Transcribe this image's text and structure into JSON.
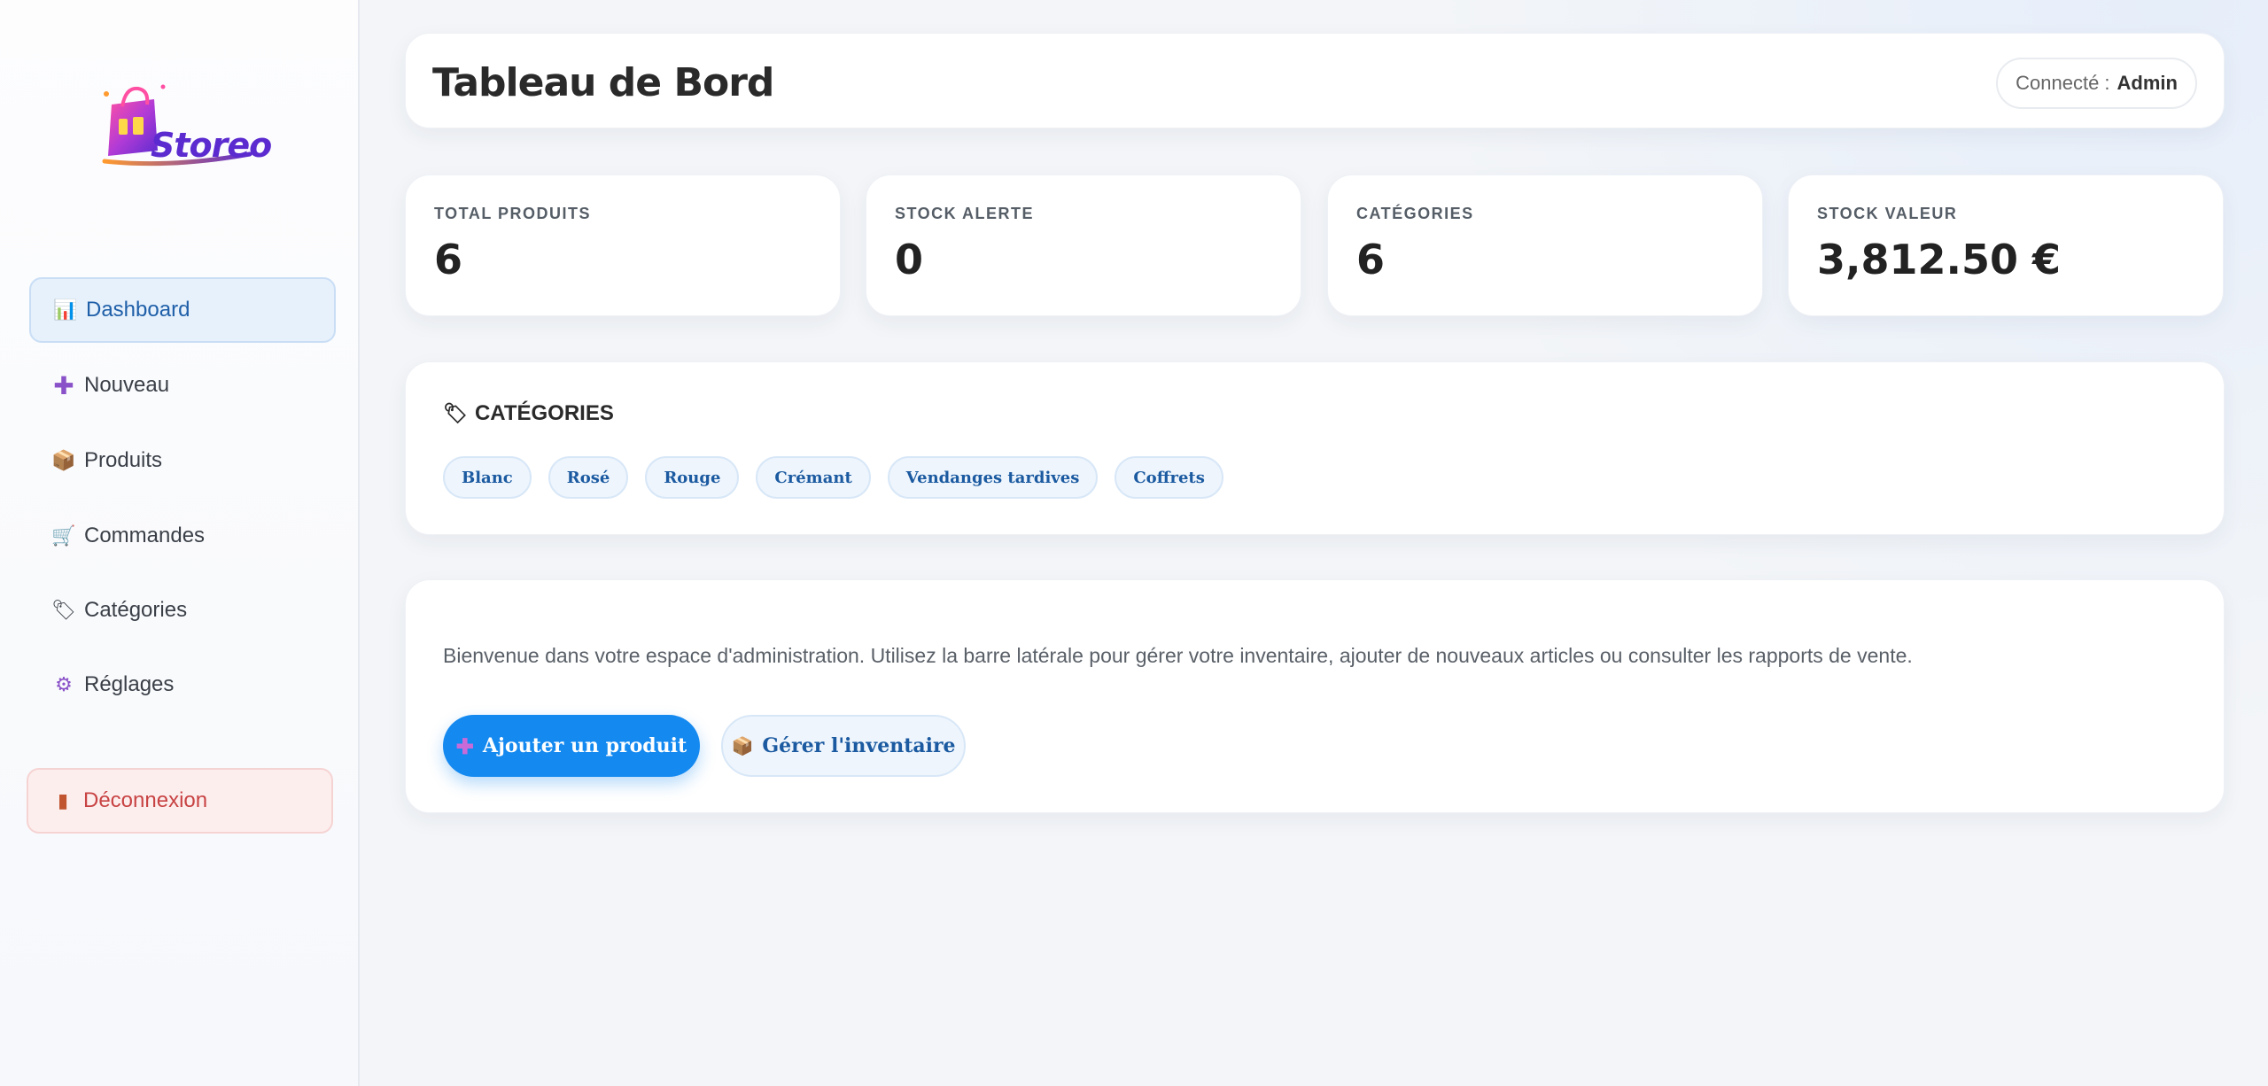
{
  "sidebar": {
    "logo_text": "Storeo",
    "items": [
      {
        "label": "Dashboard",
        "icon": "bar-chart-icon"
      },
      {
        "label": "Nouveau",
        "icon": "plus-icon"
      },
      {
        "label": "Produits",
        "icon": "package-icon"
      },
      {
        "label": "Commandes",
        "icon": "cart-icon"
      },
      {
        "label": "Catégories",
        "icon": "tag-icon"
      },
      {
        "label": "Réglages",
        "icon": "gear-icon"
      }
    ],
    "logout_label": "Déconnexion"
  },
  "header": {
    "title": "Tableau de Bord",
    "user_prefix": "Connecté :",
    "user_name": "Admin"
  },
  "stats": [
    {
      "label": "TOTAL PRODUITS",
      "value": "6"
    },
    {
      "label": "STOCK ALERTE",
      "value": "0"
    },
    {
      "label": "CATÉGORIES",
      "value": "6"
    },
    {
      "label": "STOCK VALEUR",
      "value": "3,812.50 €"
    }
  ],
  "categories": {
    "title": "CATÉGORIES",
    "items": [
      "Blanc",
      "Rosé",
      "Rouge",
      "Crémant",
      "Vendanges tardives",
      "Coffrets"
    ]
  },
  "welcome": {
    "text": "Bienvenue dans votre espace d'administration. Utilisez la barre latérale pour gérer votre inventaire, ajouter de nouveaux articles ou consulter les rapports de vente.",
    "primary_button": "Ajouter un produit",
    "secondary_button": "Gérer l'inventaire"
  },
  "colors": {
    "accent": "#1489f0",
    "active_nav_bg": "#e6f1fc",
    "logout": "#c84343",
    "chip_text": "#1b5aa0"
  }
}
